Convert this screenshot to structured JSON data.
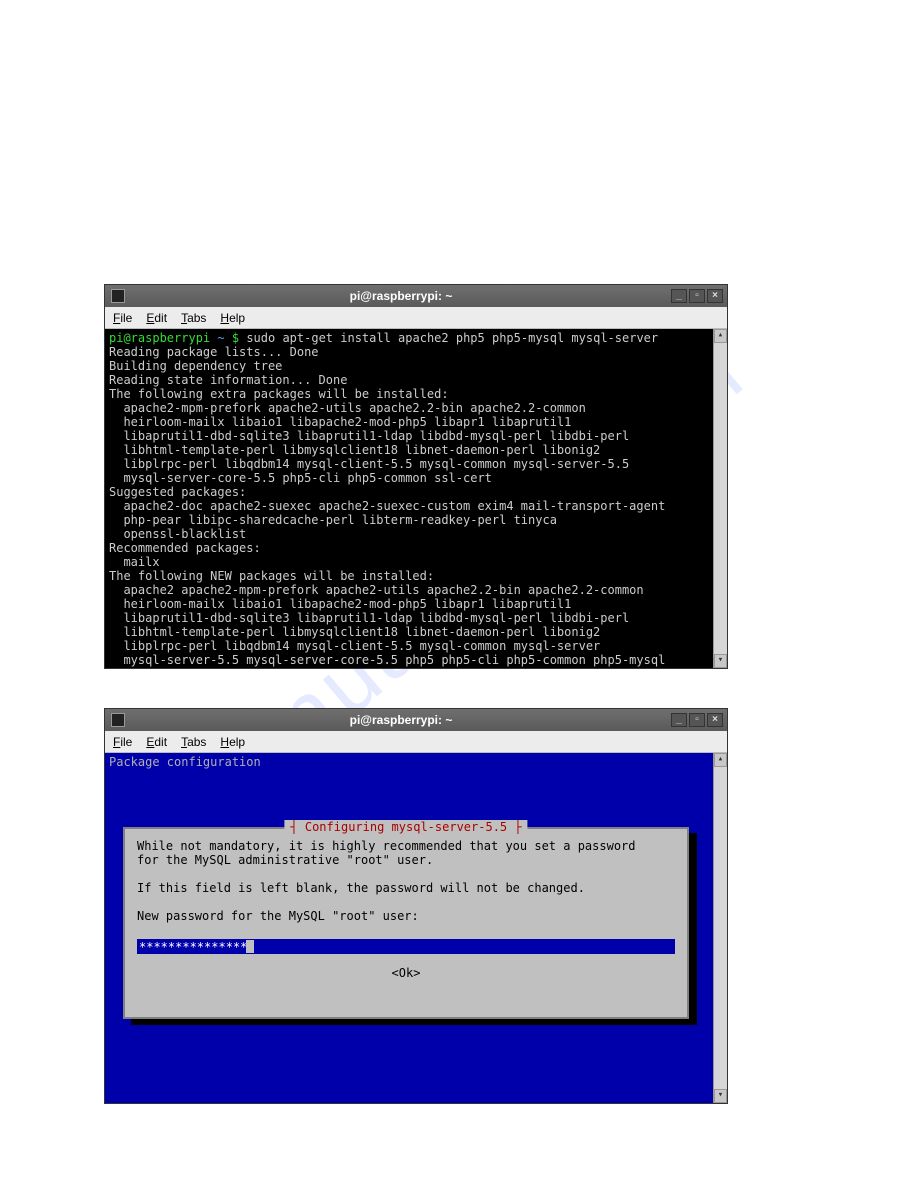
{
  "watermark": "manualhive.com",
  "window1": {
    "title": "pi@raspberrypi: ~",
    "menu": {
      "file": "File",
      "edit": "Edit",
      "tabs": "Tabs",
      "help": "Help"
    },
    "prompt_user": "pi@raspberrypi",
    "prompt_path": "~",
    "prompt_symbol": "$",
    "command": "sudo apt-get install apache2 php5 php5-mysql mysql-server",
    "output": [
      "Reading package lists... Done",
      "Building dependency tree",
      "Reading state information... Done",
      "The following extra packages will be installed:",
      "  apache2-mpm-prefork apache2-utils apache2.2-bin apache2.2-common",
      "  heirloom-mailx libaio1 libapache2-mod-php5 libapr1 libaprutil1",
      "  libaprutil1-dbd-sqlite3 libaprutil1-ldap libdbd-mysql-perl libdbi-perl",
      "  libhtml-template-perl libmysqlclient18 libnet-daemon-perl libonig2",
      "  libplrpc-perl libqdbm14 mysql-client-5.5 mysql-common mysql-server-5.5",
      "  mysql-server-core-5.5 php5-cli php5-common ssl-cert",
      "Suggested packages:",
      "  apache2-doc apache2-suexec apache2-suexec-custom exim4 mail-transport-agent",
      "  php-pear libipc-sharedcache-perl libterm-readkey-perl tinyca",
      "  openssl-blacklist",
      "Recommended packages:",
      "  mailx",
      "The following NEW packages will be installed:",
      "  apache2 apache2-mpm-prefork apache2-utils apache2.2-bin apache2.2-common",
      "  heirloom-mailx libaio1 libapache2-mod-php5 libapr1 libaprutil1",
      "  libaprutil1-dbd-sqlite3 libaprutil1-ldap libdbd-mysql-perl libdbi-perl",
      "  libhtml-template-perl libmysqlclient18 libnet-daemon-perl libonig2",
      "  libplrpc-perl libqdbm14 mysql-client-5.5 mysql-common mysql-server",
      "  mysql-server-5.5 mysql-server-core-5.5 php5 php5-cli php5-common php5-mysql"
    ]
  },
  "window2": {
    "title": "pi@raspberrypi: ~",
    "menu": {
      "file": "File",
      "edit": "Edit",
      "tabs": "Tabs",
      "help": "Help"
    },
    "header": "Package configuration",
    "dialog_title": "Configuring mysql-server-5.5",
    "body_line1": "While not mandatory, it is highly recommended that you set a password",
    "body_line2": "for the MySQL administrative \"root\" user.",
    "body_line3": "If this field is left blank, the password will not be changed.",
    "body_line4": "New password for the MySQL \"root\" user:",
    "password_mask": "***************",
    "ok_label": "<Ok>"
  },
  "winbtns": {
    "min": "_",
    "max": "▫",
    "close": "×"
  },
  "scroll": {
    "up": "▴",
    "down": "▾"
  }
}
